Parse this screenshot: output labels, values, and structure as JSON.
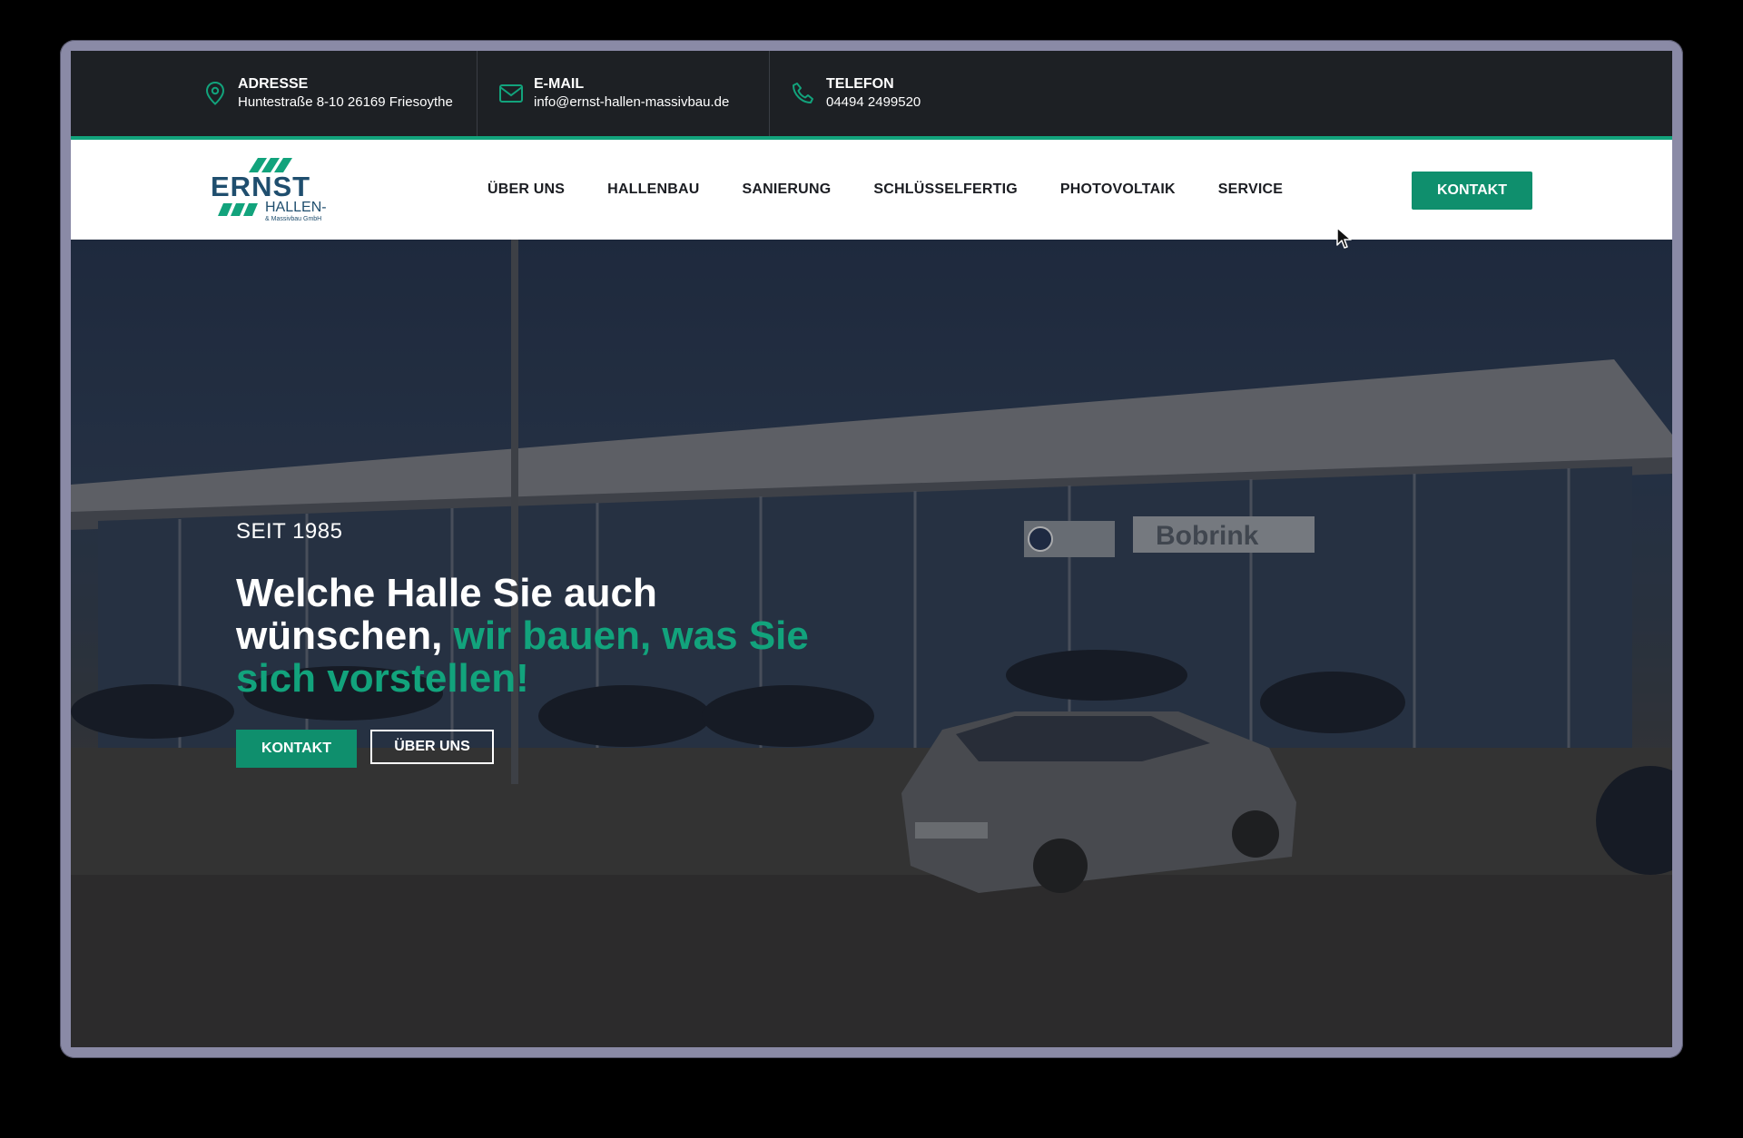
{
  "topbar": {
    "address": {
      "label": "ADRESSE",
      "value": "Huntestraße 8-10 26169 Friesoythe",
      "icon": "map-pin-icon"
    },
    "email": {
      "label": "E-MAIL",
      "value": "info@ernst-hallen-massivbau.de",
      "icon": "mail-icon"
    },
    "phone": {
      "label": "TELEFON",
      "value": "04494 2499520",
      "icon": "phone-icon"
    }
  },
  "logo": {
    "line1": "ERNST",
    "line2": "HALLEN-",
    "line3": "& Massivbau GmbH"
  },
  "nav": {
    "items": [
      "ÜBER UNS",
      "HALLENBAU",
      "SANIERUNG",
      "SCHLÜSSELFERTIG",
      "PHOTOVOLTAIK",
      "SERVICE"
    ],
    "cta": "KONTAKT"
  },
  "hero": {
    "kicker": "SEIT 1985",
    "headline_white": "Welche Halle Sie auch wünschen,",
    "headline_green": "wir bauen, was Sie sich vorstellen!",
    "btn_primary": "KONTAKT",
    "btn_secondary": "ÜBER UNS",
    "sign_text": "Bobrink"
  },
  "colors": {
    "accent": "#12a37c",
    "dark": "#1d2024",
    "button": "#0f8f6d"
  }
}
